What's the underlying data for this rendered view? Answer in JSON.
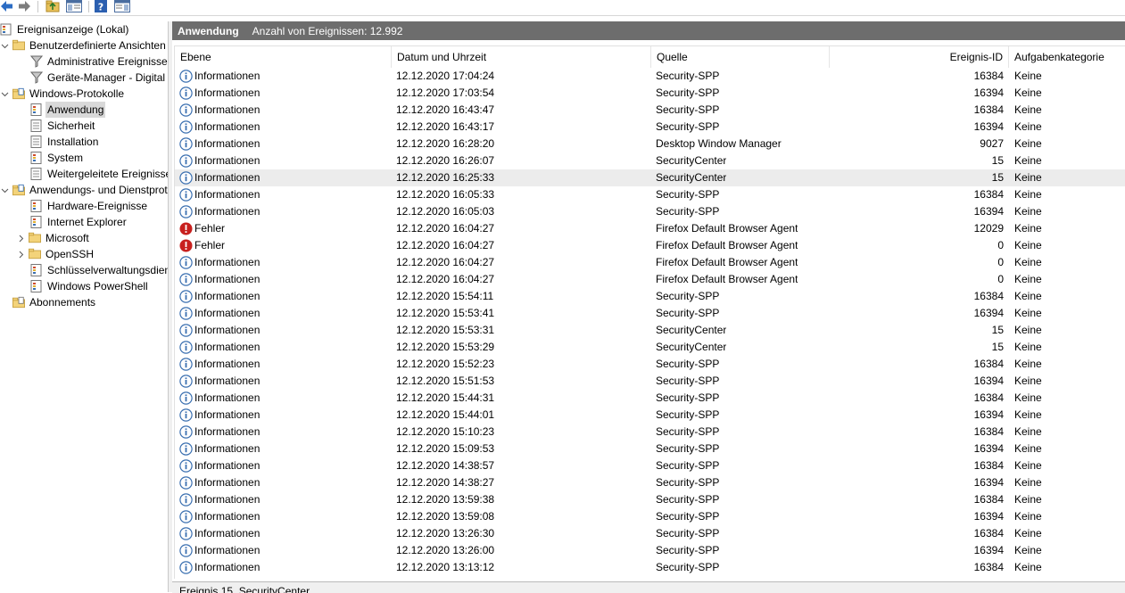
{
  "tree": {
    "root": "Ereignisanzeige (Lokal)",
    "custom_views": "Benutzerdefinierte Ansichten",
    "admin_events": "Administrative Ereignisse",
    "device_manager": "Geräte-Manager - Digital",
    "windows_logs": "Windows-Protokolle",
    "application": "Anwendung",
    "security": "Sicherheit",
    "setup": "Installation",
    "system": "System",
    "forwarded": "Weitergeleitete Ereignisse",
    "app_service_logs": "Anwendungs- und Dienstprotokolle",
    "hardware": "Hardware-Ereignisse",
    "ie": "Internet Explorer",
    "microsoft": "Microsoft",
    "openssh": "OpenSSH",
    "key_mgmt": "Schlüsselverwaltungsdienst",
    "powershell": "Windows PowerShell",
    "subscriptions": "Abonnements"
  },
  "header": {
    "title": "Anwendung",
    "count": "Anzahl von Ereignissen: 12.992"
  },
  "columns": {
    "level": "Ebene",
    "datetime": "Datum und Uhrzeit",
    "source": "Quelle",
    "event_id": "Ereignis-ID",
    "category": "Aufgabenkategorie"
  },
  "events": [
    {
      "level": "Informationen",
      "datetime": "12.12.2020 17:04:24",
      "source": "Security-SPP",
      "event_id": "16384",
      "category": "Keine",
      "type": "info"
    },
    {
      "level": "Informationen",
      "datetime": "12.12.2020 17:03:54",
      "source": "Security-SPP",
      "event_id": "16394",
      "category": "Keine",
      "type": "info"
    },
    {
      "level": "Informationen",
      "datetime": "12.12.2020 16:43:47",
      "source": "Security-SPP",
      "event_id": "16384",
      "category": "Keine",
      "type": "info"
    },
    {
      "level": "Informationen",
      "datetime": "12.12.2020 16:43:17",
      "source": "Security-SPP",
      "event_id": "16394",
      "category": "Keine",
      "type": "info"
    },
    {
      "level": "Informationen",
      "datetime": "12.12.2020 16:28:20",
      "source": "Desktop Window Manager",
      "event_id": "9027",
      "category": "Keine",
      "type": "info"
    },
    {
      "level": "Informationen",
      "datetime": "12.12.2020 16:26:07",
      "source": "SecurityCenter",
      "event_id": "15",
      "category": "Keine",
      "type": "info"
    },
    {
      "level": "Informationen",
      "datetime": "12.12.2020 16:25:33",
      "source": "SecurityCenter",
      "event_id": "15",
      "category": "Keine",
      "type": "info",
      "highlight": true
    },
    {
      "level": "Informationen",
      "datetime": "12.12.2020 16:05:33",
      "source": "Security-SPP",
      "event_id": "16384",
      "category": "Keine",
      "type": "info"
    },
    {
      "level": "Informationen",
      "datetime": "12.12.2020 16:05:03",
      "source": "Security-SPP",
      "event_id": "16394",
      "category": "Keine",
      "type": "info"
    },
    {
      "level": "Fehler",
      "datetime": "12.12.2020 16:04:27",
      "source": "Firefox Default Browser Agent",
      "event_id": "12029",
      "category": "Keine",
      "type": "error"
    },
    {
      "level": "Fehler",
      "datetime": "12.12.2020 16:04:27",
      "source": "Firefox Default Browser Agent",
      "event_id": "0",
      "category": "Keine",
      "type": "error"
    },
    {
      "level": "Informationen",
      "datetime": "12.12.2020 16:04:27",
      "source": "Firefox Default Browser Agent",
      "event_id": "0",
      "category": "Keine",
      "type": "info"
    },
    {
      "level": "Informationen",
      "datetime": "12.12.2020 16:04:27",
      "source": "Firefox Default Browser Agent",
      "event_id": "0",
      "category": "Keine",
      "type": "info"
    },
    {
      "level": "Informationen",
      "datetime": "12.12.2020 15:54:11",
      "source": "Security-SPP",
      "event_id": "16384",
      "category": "Keine",
      "type": "info"
    },
    {
      "level": "Informationen",
      "datetime": "12.12.2020 15:53:41",
      "source": "Security-SPP",
      "event_id": "16394",
      "category": "Keine",
      "type": "info"
    },
    {
      "level": "Informationen",
      "datetime": "12.12.2020 15:53:31",
      "source": "SecurityCenter",
      "event_id": "15",
      "category": "Keine",
      "type": "info"
    },
    {
      "level": "Informationen",
      "datetime": "12.12.2020 15:53:29",
      "source": "SecurityCenter",
      "event_id": "15",
      "category": "Keine",
      "type": "info"
    },
    {
      "level": "Informationen",
      "datetime": "12.12.2020 15:52:23",
      "source": "Security-SPP",
      "event_id": "16384",
      "category": "Keine",
      "type": "info"
    },
    {
      "level": "Informationen",
      "datetime": "12.12.2020 15:51:53",
      "source": "Security-SPP",
      "event_id": "16394",
      "category": "Keine",
      "type": "info"
    },
    {
      "level": "Informationen",
      "datetime": "12.12.2020 15:44:31",
      "source": "Security-SPP",
      "event_id": "16384",
      "category": "Keine",
      "type": "info"
    },
    {
      "level": "Informationen",
      "datetime": "12.12.2020 15:44:01",
      "source": "Security-SPP",
      "event_id": "16394",
      "category": "Keine",
      "type": "info"
    },
    {
      "level": "Informationen",
      "datetime": "12.12.2020 15:10:23",
      "source": "Security-SPP",
      "event_id": "16384",
      "category": "Keine",
      "type": "info"
    },
    {
      "level": "Informationen",
      "datetime": "12.12.2020 15:09:53",
      "source": "Security-SPP",
      "event_id": "16394",
      "category": "Keine",
      "type": "info"
    },
    {
      "level": "Informationen",
      "datetime": "12.12.2020 14:38:57",
      "source": "Security-SPP",
      "event_id": "16384",
      "category": "Keine",
      "type": "info"
    },
    {
      "level": "Informationen",
      "datetime": "12.12.2020 14:38:27",
      "source": "Security-SPP",
      "event_id": "16394",
      "category": "Keine",
      "type": "info"
    },
    {
      "level": "Informationen",
      "datetime": "12.12.2020 13:59:38",
      "source": "Security-SPP",
      "event_id": "16384",
      "category": "Keine",
      "type": "info"
    },
    {
      "level": "Informationen",
      "datetime": "12.12.2020 13:59:08",
      "source": "Security-SPP",
      "event_id": "16394",
      "category": "Keine",
      "type": "info"
    },
    {
      "level": "Informationen",
      "datetime": "12.12.2020 13:26:30",
      "source": "Security-SPP",
      "event_id": "16384",
      "category": "Keine",
      "type": "info"
    },
    {
      "level": "Informationen",
      "datetime": "12.12.2020 13:26:00",
      "source": "Security-SPP",
      "event_id": "16394",
      "category": "Keine",
      "type": "info"
    },
    {
      "level": "Informationen",
      "datetime": "12.12.2020 13:13:12",
      "source": "Security-SPP",
      "event_id": "16384",
      "category": "Keine",
      "type": "info"
    }
  ],
  "detail": {
    "text": "Ereignis 15, SecurityCenter"
  },
  "colors": {
    "header_bar": "#6d6d6d",
    "selected_node": "#d9d9d9",
    "info_icon": "#3a6fb0",
    "error_icon": "#c8201e"
  },
  "icons": {
    "back": "arrow-left-icon",
    "forward": "arrow-right-icon",
    "up": "folder-up-icon",
    "show_hide": "console-tree-icon",
    "help": "help-icon",
    "view": "action-pane-icon"
  }
}
